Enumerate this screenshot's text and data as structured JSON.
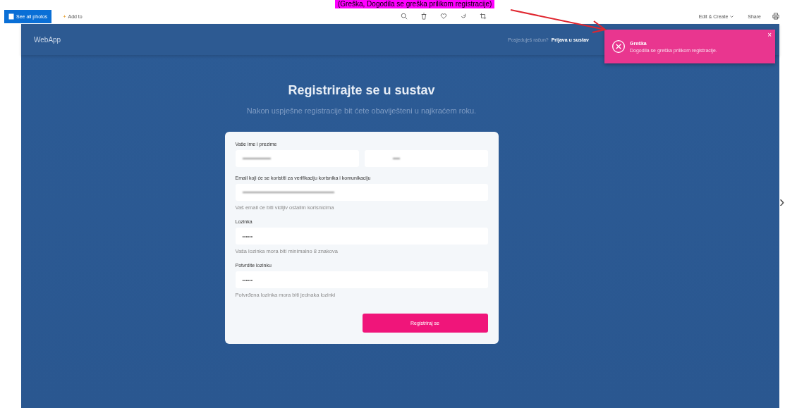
{
  "document_text": {
    "highlighted": "(Greška, Dogodila se greška prilikom registracije)"
  },
  "viewer_toolbar": {
    "left": [
      {
        "label": "See all photos",
        "kind": "primary"
      },
      {
        "label": "Add to",
        "kind": "add",
        "icon": "+"
      }
    ],
    "tools": [
      {
        "kind": "zoom"
      },
      {
        "kind": "delete"
      },
      {
        "kind": "favorite"
      },
      {
        "kind": "rotate"
      },
      {
        "kind": "crop"
      }
    ],
    "right": [
      {
        "label": "Edit & Create",
        "kind": "edit"
      },
      {
        "label": "Share",
        "kind": "share"
      }
    ]
  },
  "webapp": {
    "brand": "WebApp",
    "account_question": "Posjeduješ račun?",
    "login_link": "Prijava u sustav",
    "title": "Registrirajte se u sustav",
    "subtitle": "Nakon uspješne registracije bit ćete obaviješteni u najkraćem roku.",
    "fields": [
      {
        "label": "Vaše ime i prezime",
        "kind": "split"
      },
      {
        "label": "Email koji će se koristiti za verifikaciju korisnika i komunikaciju",
        "kind": "blurred",
        "hint": "Vaš email će biti vidljiv ostalim korisnicima"
      },
      {
        "label": "Lozinka",
        "kind": "password",
        "value": "••••••",
        "hint": "Vaša lozinka mora biti minimalno 8 znakova"
      },
      {
        "label": "Potvrdite lozinku",
        "kind": "password",
        "value": "••••••",
        "hint": "Potvrđena lozinka mora biti jednaka lozinki"
      }
    ],
    "submit": "Registriraj se"
  },
  "toast": {
    "title": "Greška",
    "message": "Dogodila se greška prilikom registracije.",
    "close": "×"
  },
  "next_arrow": "›"
}
